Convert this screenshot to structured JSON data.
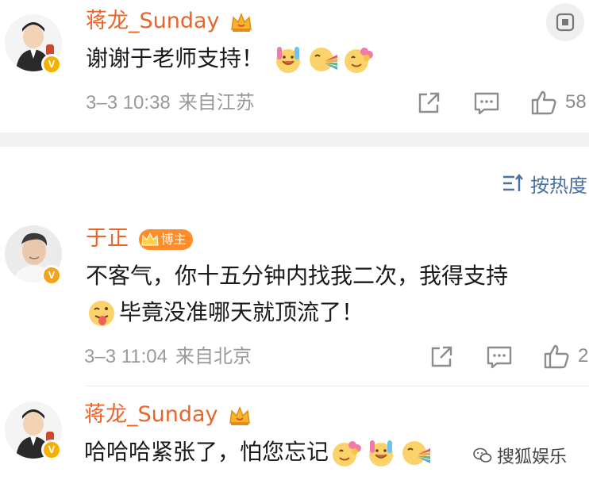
{
  "comments": [
    {
      "username": "蒋龙_Sunday",
      "text_line1": "谢谢于老师支持！",
      "time": "3–3 10:38",
      "location": "来自江苏",
      "likes": "58",
      "emojis": [
        "ice-cream-emoji",
        "rainbow-emoji",
        "flower-emoji"
      ]
    },
    {
      "username": "于正",
      "badge": "博主",
      "text_line1": "不客气，你十五分钟内找我二次，我得支持",
      "text_line2": "毕竟没准哪天就顶流了！",
      "time": "3–3 11:04",
      "location": "来自北京",
      "likes": "2",
      "emojis": [
        "tongue-emoji"
      ]
    },
    {
      "username": "蒋龙_Sunday",
      "text_line1": "哈哈哈紧张了，怕您忘记",
      "emojis": [
        "flower-emoji",
        "ice-cream-emoji",
        "rainbow-emoji"
      ]
    }
  ],
  "sort": {
    "label": "按热度"
  },
  "watermark": {
    "label": "搜狐娱乐"
  },
  "colors": {
    "username": "#e9652b",
    "meta": "#9a9a9a",
    "sort": "#4a6fa3"
  }
}
